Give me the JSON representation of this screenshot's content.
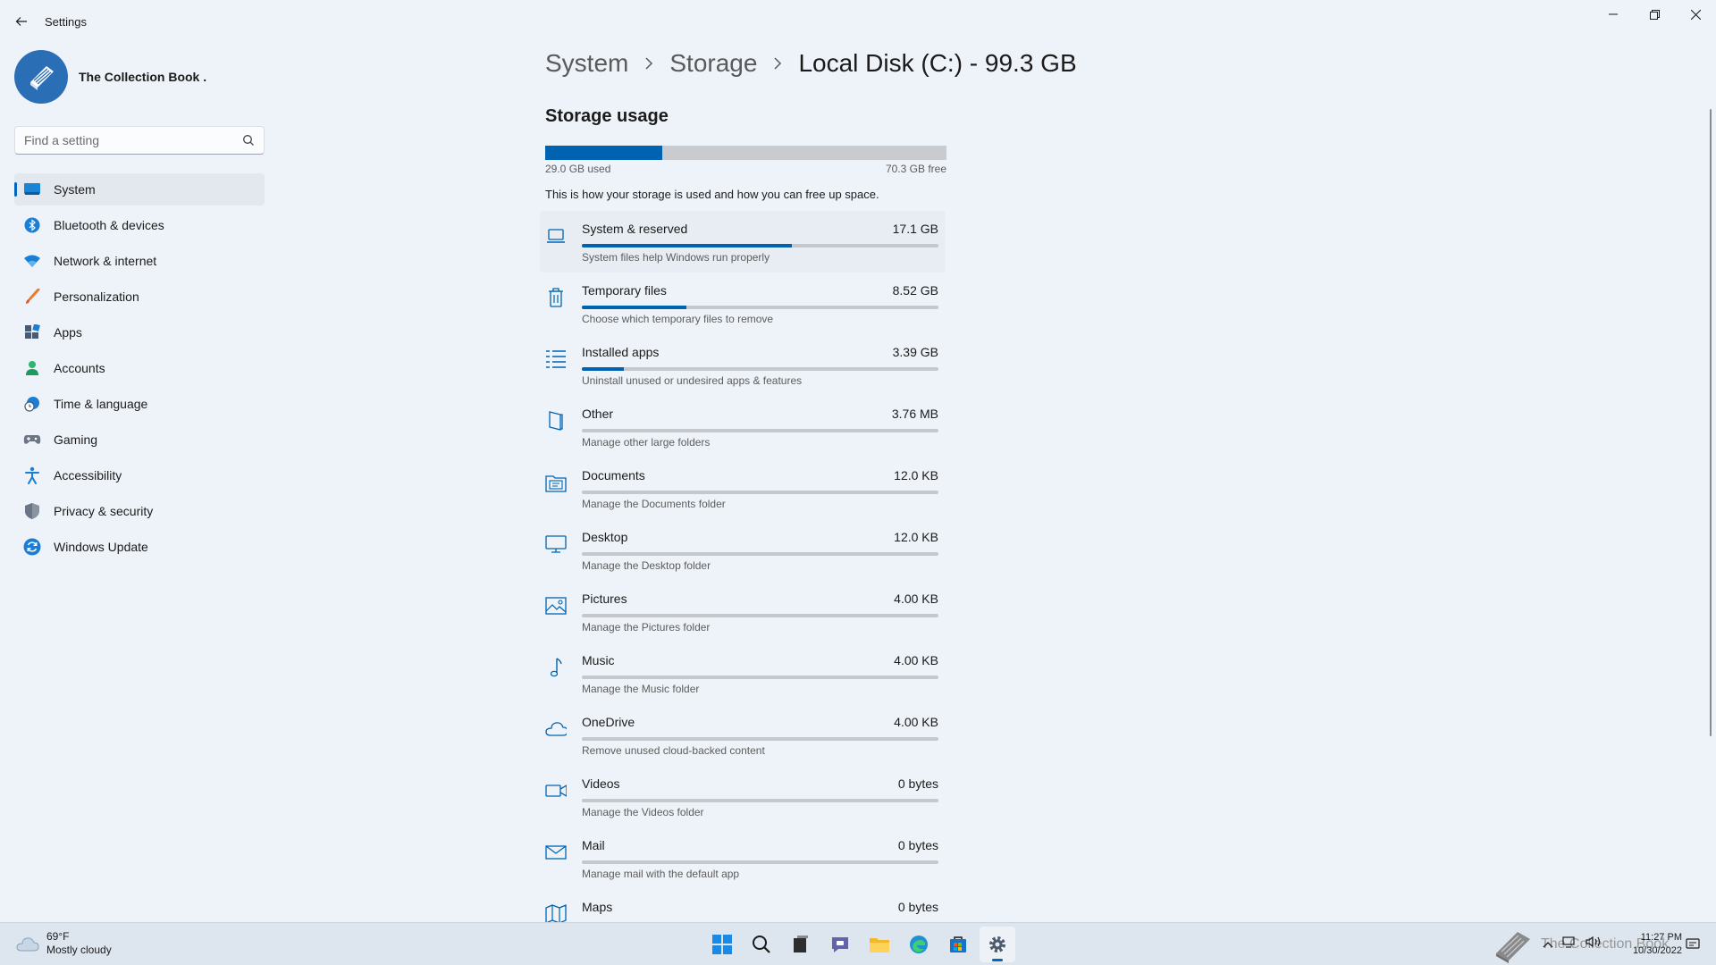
{
  "window": {
    "title": "Settings",
    "controls": [
      "minimize-icon",
      "restore-icon",
      "close-icon"
    ]
  },
  "profile": {
    "name": "The Collection Book ."
  },
  "search": {
    "placeholder": "Find a setting"
  },
  "sidebar": {
    "items": [
      {
        "label": "System",
        "icon": "system-icon",
        "active": true
      },
      {
        "label": "Bluetooth & devices",
        "icon": "bluetooth-icon"
      },
      {
        "label": "Network & internet",
        "icon": "wifi-icon"
      },
      {
        "label": "Personalization",
        "icon": "brush-icon"
      },
      {
        "label": "Apps",
        "icon": "apps-icon"
      },
      {
        "label": "Accounts",
        "icon": "accounts-icon"
      },
      {
        "label": "Time & language",
        "icon": "clock-globe-icon"
      },
      {
        "label": "Gaming",
        "icon": "gamepad-icon"
      },
      {
        "label": "Accessibility",
        "icon": "accessibility-icon"
      },
      {
        "label": "Privacy & security",
        "icon": "shield-icon"
      },
      {
        "label": "Windows Update",
        "icon": "update-icon"
      }
    ]
  },
  "breadcrumb": [
    "System",
    "Storage",
    "Local Disk (C:) - 99.3 GB"
  ],
  "storage": {
    "title": "Storage usage",
    "used_label": "29.0 GB used",
    "free_label": "70.3 GB free",
    "used_fraction": 0.292,
    "hint": "This is how your storage is used and how you can free up space.",
    "categories": [
      {
        "name": "System & reserved",
        "size": "17.1 GB",
        "desc": "System files help Windows run properly",
        "fraction": 0.59,
        "icon": "laptop-icon"
      },
      {
        "name": "Temporary files",
        "size": "8.52 GB",
        "desc": "Choose which temporary files to remove",
        "fraction": 0.294,
        "icon": "trash-icon"
      },
      {
        "name": "Installed apps",
        "size": "3.39 GB",
        "desc": "Uninstall unused or undesired apps & features",
        "fraction": 0.117,
        "icon": "list-icon"
      },
      {
        "name": "Other",
        "size": "3.76 MB",
        "desc": "Manage other large folders",
        "fraction": 0,
        "icon": "folder-other-icon"
      },
      {
        "name": "Documents",
        "size": "12.0 KB",
        "desc": "Manage the Documents folder",
        "fraction": 0,
        "icon": "documents-icon"
      },
      {
        "name": "Desktop",
        "size": "12.0 KB",
        "desc": "Manage the Desktop folder",
        "fraction": 0,
        "icon": "desktop-icon"
      },
      {
        "name": "Pictures",
        "size": "4.00 KB",
        "desc": "Manage the Pictures folder",
        "fraction": 0,
        "icon": "pictures-icon"
      },
      {
        "name": "Music",
        "size": "4.00 KB",
        "desc": "Manage the Music folder",
        "fraction": 0,
        "icon": "music-icon"
      },
      {
        "name": "OneDrive",
        "size": "4.00 KB",
        "desc": "Remove unused cloud-backed content",
        "fraction": 0,
        "icon": "cloud-icon"
      },
      {
        "name": "Videos",
        "size": "0 bytes",
        "desc": "Manage the Videos folder",
        "fraction": 0,
        "icon": "video-icon"
      },
      {
        "name": "Mail",
        "size": "0 bytes",
        "desc": "Manage mail with the default app",
        "fraction": 0,
        "icon": "mail-icon"
      },
      {
        "name": "Maps",
        "size": "0 bytes",
        "desc": "",
        "fraction": 0,
        "icon": "map-icon"
      }
    ]
  },
  "taskbar": {
    "weather_temp": "69°F",
    "weather_desc": "Mostly cloudy",
    "apps": [
      "windows-start-icon",
      "search-icon",
      "task-view-icon",
      "teams-chat-icon",
      "file-explorer-icon",
      "edge-icon",
      "store-icon",
      "settings-icon"
    ],
    "time": "11:27 PM",
    "date": "10/30/2022",
    "watermark": "The Collection Book"
  },
  "colors": {
    "accent": "#0063b1",
    "background": "#eef3f9",
    "bar_track": "#c4c7cb"
  }
}
